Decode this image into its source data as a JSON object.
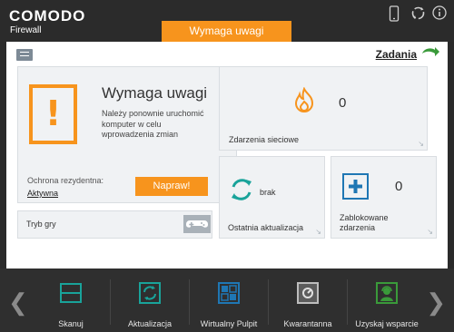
{
  "app": {
    "brand": "COMODO",
    "product": "Firewall"
  },
  "status_tab": "Wymaga uwagi",
  "titlebar_icons": [
    "phone-icon",
    "refresh-icon",
    "info-icon"
  ],
  "tasks": {
    "label": "Zadania",
    "icon": "arrow-right-icon"
  },
  "warning": {
    "title": "Wymaga uwagi",
    "message": "Należy ponownie uruchomić komputer w celu wprowadzenia zmian",
    "protection_label": "Ochrona rezydentna:",
    "protection_value": "Aktywna",
    "fix_button": "Napraw!"
  },
  "game_mode": {
    "label": "Tryb gry"
  },
  "network_events": {
    "label": "Zdarzenia sieciowe",
    "count": "0"
  },
  "update": {
    "label": "Ostatnia aktualizacja",
    "status": "brak"
  },
  "blocked": {
    "label": "Zablokowane zdarzenia",
    "count": "0"
  },
  "bottom_nav": [
    {
      "label": "Skanuj",
      "icon": "scan-icon"
    },
    {
      "label": "Aktualizacja",
      "icon": "update-icon"
    },
    {
      "label": "Wirtualny Pulpit",
      "icon": "virtual-desktop-icon"
    },
    {
      "label": "Kwarantanna",
      "icon": "quarantine-icon"
    },
    {
      "label": "Uzyskaj wsparcie",
      "icon": "support-icon"
    }
  ],
  "colors": {
    "accent": "#f7941d",
    "teal": "#19a39a",
    "blue": "#1f77b4",
    "green": "#3a9a3a"
  }
}
